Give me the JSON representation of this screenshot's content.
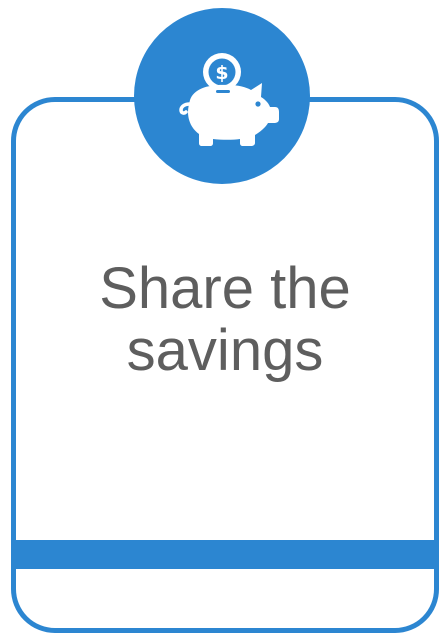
{
  "card": {
    "title_line1": "Share the",
    "title_line2": "savings",
    "icon": "piggy-bank-dollar-icon"
  },
  "colors": {
    "accent": "#2c86d1",
    "text": "#5e5e5e",
    "background": "#ffffff"
  }
}
